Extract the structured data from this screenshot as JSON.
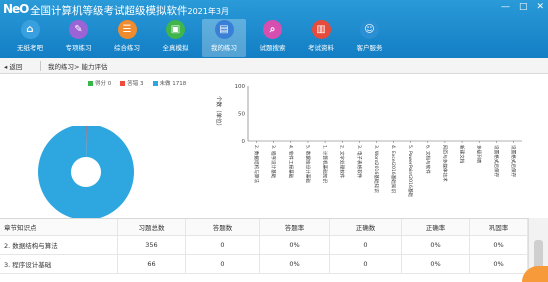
{
  "window": {
    "title": "全国计算机等级考试超级模拟软件",
    "year": "2021年3月",
    "logo": "NeO"
  },
  "nav": [
    {
      "label": "无纸考吧",
      "icon": "home-icon",
      "color": "#39a0e0",
      "glyph": "⌂"
    },
    {
      "label": "专项练习",
      "icon": "pencil-icon",
      "color": "#9b63d6",
      "glyph": "✎"
    },
    {
      "label": "综合练习",
      "icon": "clipboard-icon",
      "color": "#f08c2e",
      "glyph": "☰"
    },
    {
      "label": "全真模拟",
      "icon": "monitor-icon",
      "color": "#3fb54b",
      "glyph": "▣"
    },
    {
      "label": "我的练习",
      "icon": "document-icon",
      "color": "#3a7fd6",
      "glyph": "▤"
    },
    {
      "label": "试题搜索",
      "icon": "search-icon",
      "color": "#d64fb0",
      "glyph": "⌕"
    },
    {
      "label": "考试资料",
      "icon": "book-icon",
      "color": "#e64b3c",
      "glyph": "▥"
    },
    {
      "label": "客户服务",
      "icon": "user-service-icon",
      "color": "#2a8fd3",
      "glyph": "☺"
    }
  ],
  "active_nav": 4,
  "toolbar": {
    "back": "返回",
    "breadcrumb": "我的练习> 能力评估"
  },
  "legend": [
    {
      "label": "得分 0",
      "color": "#3bb54a"
    },
    {
      "label": "答错 3",
      "color": "#ef4b3f"
    },
    {
      "label": "未做 1718",
      "color": "#2ea7e0"
    }
  ],
  "chart_data": [
    {
      "type": "pie",
      "title": "",
      "legend": [
        "得分 0",
        "答错 3",
        "未做 1718"
      ],
      "values": [
        0,
        3,
        1718
      ],
      "colors": [
        "#3bb54a",
        "#ef4b3f",
        "#2ea7e0"
      ]
    },
    {
      "type": "bar",
      "title": "",
      "ylabel": "个数（单位）",
      "ylim": [
        0,
        100
      ],
      "yticks": [
        0,
        50,
        100
      ],
      "categories": [
        "2. 数据结构与算法",
        "3. 程序设计基础",
        "4. 软件工程基础",
        "5. 数据库设计基础",
        "1. 计算机基础知识",
        "2. 文字处理软件",
        "3. 电子表格软件",
        "3. Word2016基础知识",
        "4. Excel2016基础知识",
        "5. PowerPoint2016基础",
        "6. 文档与软件",
        "网页与多媒体技术",
        "新建文档",
        "多级列表",
        "设置格式后保存",
        "设置格式后保存"
      ],
      "values": [
        0,
        0,
        0,
        0,
        0,
        0,
        0,
        0,
        0,
        0,
        0,
        0,
        0,
        0,
        0,
        0
      ]
    }
  ],
  "table": {
    "headers": [
      "章节知识点",
      "习题总数",
      "答题数",
      "答题率",
      "正确数",
      "正确率",
      "巩固率"
    ],
    "rows": [
      [
        "2. 数据结构与算法",
        "356",
        "0",
        "0%",
        "0",
        "0%",
        "0%"
      ],
      [
        "3. 程序设计基础",
        "66",
        "0",
        "0%",
        "0",
        "0%",
        "0%"
      ]
    ]
  }
}
